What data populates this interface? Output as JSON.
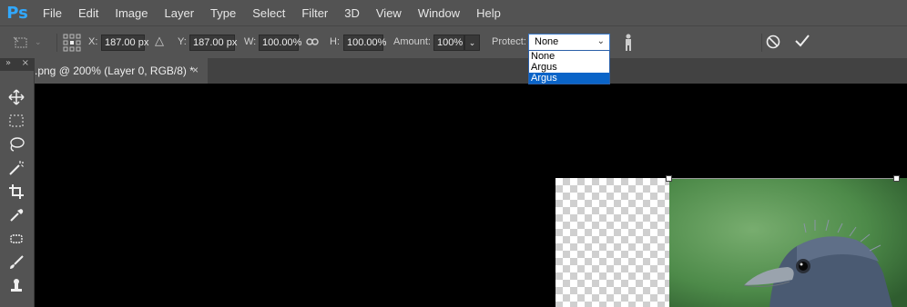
{
  "app": {
    "logo": "Ps"
  },
  "menu": [
    "File",
    "Edit",
    "Image",
    "Layer",
    "Type",
    "Select",
    "Filter",
    "3D",
    "View",
    "Window",
    "Help"
  ],
  "options": {
    "x_label": "X:",
    "x_value": "187.00 px",
    "y_label": "Y:",
    "y_value": "187.00 px",
    "w_label": "W:",
    "w_value": "100.00%",
    "h_label": "H:",
    "h_value": "100.00%",
    "amount_label": "Amount:",
    "amount_value": "100%",
    "protect_label": "Protect:",
    "protect_value": "None",
    "protect_options": [
      "None",
      "Argus",
      "Argus"
    ],
    "protect_highlighted_index": 2
  },
  "document": {
    "tab_title": ".png @ 200% (Layer 0, RGB/8) *",
    "close_glyph": "×"
  },
  "panel": {
    "collapse_left": "»",
    "collapse_right": "×"
  },
  "toolbar": [
    "move-icon",
    "marquee-icon",
    "lasso-icon",
    "magic-wand-icon",
    "crop-icon",
    "eyedropper-icon",
    "healing-icon",
    "brush-icon",
    "clone-stamp-icon",
    "more-icon"
  ],
  "colors": {
    "accent": "#31a8ff",
    "chrome": "#535353",
    "highlight": "#0a64c8"
  }
}
